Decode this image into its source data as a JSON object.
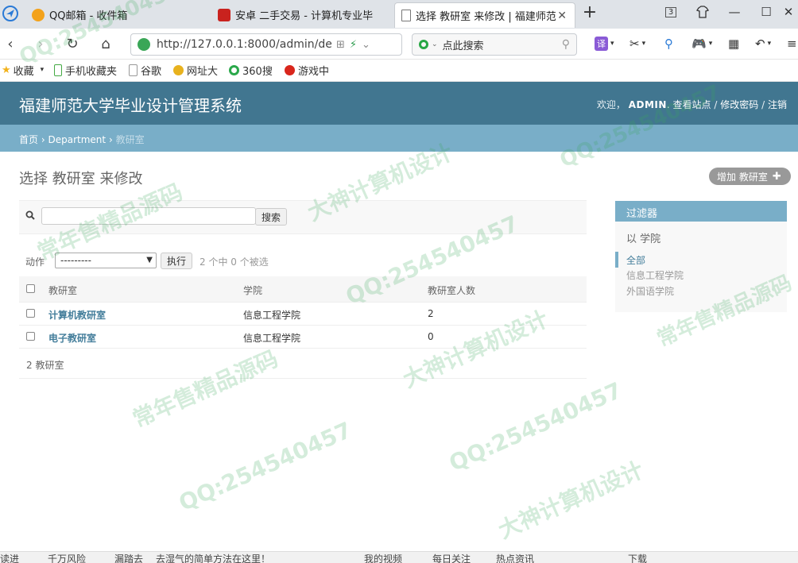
{
  "browser": {
    "tabs": [
      {
        "title": "QQ邮箱 - 收件箱",
        "active": false
      },
      {
        "title": "安卓 二手交易 - 计算机专业毕",
        "active": false
      },
      {
        "title": "选择 教研室 来修改 | 福建师范",
        "active": true
      }
    ],
    "new_tab_label": "+",
    "tab_count": "3",
    "url": "http://127.0.0.1:8000/admin/dep",
    "search_placeholder": "点此搜索",
    "bookmarks": [
      "收藏",
      "手机收藏夹",
      "谷歌",
      "网址大",
      "360搜",
      "游戏中"
    ]
  },
  "admin": {
    "site_title": "福建师范大学毕业设计管理系统",
    "user_tools": {
      "welcome": "欢迎，",
      "username": "ADMIN",
      "view_site": "查看站点",
      "change_password": "修改密码",
      "logout": "注销",
      "sep": "/"
    },
    "breadcrumbs": {
      "home": "首页",
      "app": "Department",
      "model": "教研室",
      "sep": "›"
    },
    "page_title": "选择 教研室 来修改",
    "add_button": "增加 教研室",
    "search_button": "搜索",
    "actions": {
      "label": "动作",
      "selected_option": "---------",
      "go_button": "执行",
      "counter": "2 个中 0 个被选"
    },
    "table": {
      "headers": [
        "教研室",
        "学院",
        "教研室人数"
      ],
      "rows": [
        [
          "计算机教研室",
          "信息工程学院",
          "2"
        ],
        [
          "电子教研室",
          "信息工程学院",
          "0"
        ]
      ]
    },
    "paginator": "2 教研室",
    "filter": {
      "title": "过滤器",
      "by": "以 学院",
      "options": [
        "全部",
        "信息工程学院",
        "外国语学院"
      ],
      "selected": "全部"
    }
  },
  "statusbar": [
    "读进",
    "千万风险",
    "漏踏去",
    "去湿气的简单方法在这里！",
    "我的视频",
    "每日关注",
    "热点资讯",
    "下载"
  ],
  "watermark": [
    "常年售精品源码",
    "QQ:254540457",
    "大神计算机设计"
  ],
  "colors": {
    "header": "#417690",
    "breadcrumbs": "#79aec8",
    "link": "#447e9b"
  }
}
